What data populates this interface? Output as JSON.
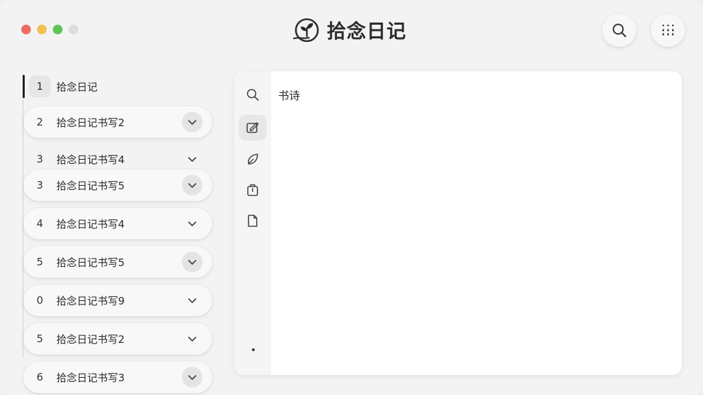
{
  "window": {
    "title": "拾念日记",
    "logo_icon": "sprout-icon"
  },
  "header": {
    "search_icon": "search-icon",
    "menu_icon": "grid-menu-icon"
  },
  "sidebar": {
    "active": {
      "num": "1",
      "label": "拾念日记"
    },
    "items": [
      {
        "num": "2",
        "label": "拾念日记书写2"
      },
      {
        "num": "3",
        "label": "拾念日记书写4"
      },
      {
        "num": "3",
        "label": "拾念日记书写5"
      },
      {
        "num": "4",
        "label": "拾念日记书写4"
      },
      {
        "num": "5",
        "label": "拾念日记书写5"
      },
      {
        "num": "0",
        "label": "拾念日记书写9"
      },
      {
        "num": "5",
        "label": "拾念日记书写2"
      },
      {
        "num": "6",
        "label": "拾念日记书写3"
      }
    ]
  },
  "toolbar": {
    "tools": [
      "search-icon",
      "edit-icon",
      "leaf-icon",
      "bag-icon",
      "document-icon"
    ]
  },
  "editor": {
    "content": "书诗"
  },
  "colors": {
    "background": "#f3f3f3",
    "panel": "#ffffff",
    "traffic_red": "#ec6b66",
    "traffic_yellow": "#f3bf4f",
    "traffic_green": "#61c554"
  }
}
